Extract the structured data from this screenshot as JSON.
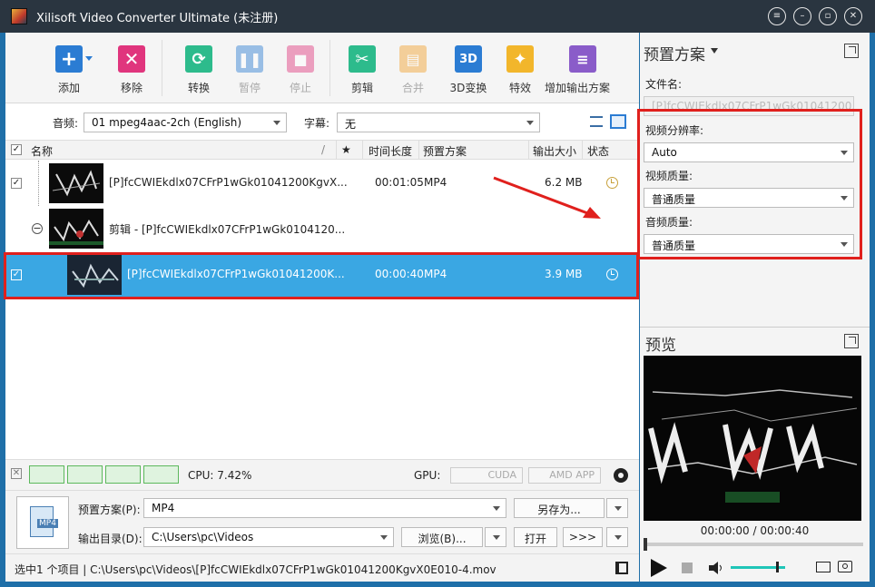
{
  "window": {
    "title": "Xilisoft Video Converter Ultimate (未注册)"
  },
  "toolbar": {
    "add": "添加",
    "remove": "移除",
    "convert": "转换",
    "pause": "暂停",
    "stop": "停止",
    "clip": "剪辑",
    "merge": "合并",
    "three_d": "3D变换",
    "effects": "特效",
    "add_profile": "增加输出方案",
    "three_d_icon": "3D"
  },
  "filter": {
    "audio_label": "音频:",
    "audio_value": "01 mpeg4aac-2ch (English)",
    "subtitle_label": "字幕:",
    "subtitle_value": "无"
  },
  "list_header": {
    "name": "名称",
    "sort": "/",
    "star": "★",
    "duration": "时间长度",
    "profile": "预置方案",
    "size": "输出大小",
    "status": "状态"
  },
  "rows": [
    {
      "name": "[P]fcCWIEkdlx07CFrP1wGk01041200KgvX...",
      "duration": "00:01:05",
      "profile": "MP4",
      "size": "6.2 MB",
      "checked": true
    },
    {
      "name": "剪辑 - [P]fcCWIEkdlx07CFrP1wGk0104120...",
      "collapse": "−"
    },
    {
      "name": "[P]fcCWIEkdlx07CFrP1wGk01041200K...",
      "duration": "00:00:40",
      "profile": "MP4",
      "size": "3.9 MB",
      "checked": true
    }
  ],
  "status": {
    "cpu": "CPU: 7.42%",
    "gpu_label": "GPU:",
    "cuda": "CUDA",
    "amd": "AMD APP"
  },
  "bottom": {
    "profile_label": "预置方案(P):",
    "profile_value": "MP4",
    "save_as": "另存为...",
    "output_label": "输出目录(D):",
    "output_value": "C:\\Users\\pc\\Videos",
    "browse": "浏览(B)...",
    "open": "打开",
    "file_icon": "MP4",
    "ext_arrows": ">>>"
  },
  "statusbar": {
    "text": "选中1 个项目 | C:\\Users\\pc\\Videos\\[P]fcCWIEkdlx07CFrP1wGk01041200KgvX0E010-4.mov"
  },
  "right_panel": {
    "title": "预置方案",
    "filename_label": "文件名:",
    "filename_value": "[P]fcCWIEkdlx07CFrP1wGk01041200...",
    "resolution_label": "视频分辨率:",
    "resolution_value": "Auto",
    "video_quality_label": "视频质量:",
    "video_quality_value": "普通质量",
    "audio_quality_label": "音频质量:",
    "audio_quality_value": "普通质量",
    "preview_title": "预览",
    "timecode": "00:00:00 / 00:00:40"
  },
  "colors": {
    "selected_row": "#3aa7e3",
    "highlight": "#e0201d",
    "titlebar": "#2a3540"
  }
}
